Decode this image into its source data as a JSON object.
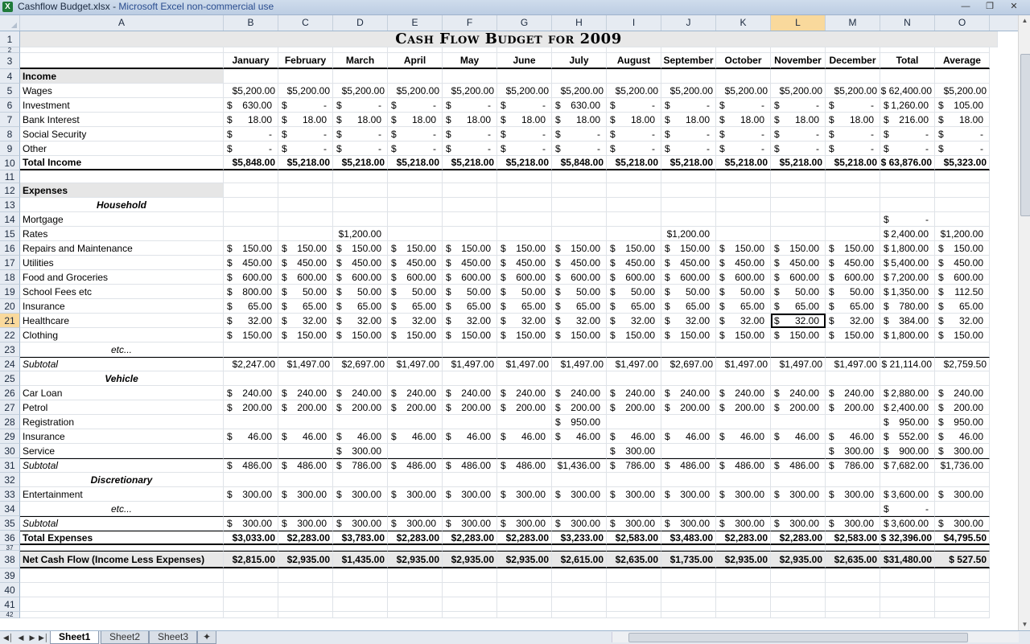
{
  "window": {
    "file_name": "Cashflow Budget.xlsx",
    "separator": " - ",
    "app_name": "Microsoft Excel non-commercial use",
    "icon_label": "X"
  },
  "columns": [
    "A",
    "B",
    "C",
    "D",
    "E",
    "F",
    "G",
    "H",
    "I",
    "J",
    "K",
    "L",
    "M",
    "N",
    "O"
  ],
  "selected_column": "L",
  "selected_row": 21,
  "sheet_title": "Cash Flow Budget for 2009",
  "month_headers": [
    "January",
    "February",
    "March",
    "April",
    "May",
    "June",
    "July",
    "August",
    "September",
    "October",
    "November",
    "December",
    "Total",
    "Average"
  ],
  "rows": [
    {
      "n": 1,
      "type": "title"
    },
    {
      "n": 2,
      "type": "blank"
    },
    {
      "n": 3,
      "type": "headers"
    },
    {
      "n": 4,
      "type": "section",
      "label": "Income"
    },
    {
      "n": 5,
      "label": "Wages",
      "vals": [
        "$5,200.00",
        "$5,200.00",
        "$5,200.00",
        "$5,200.00",
        "$5,200.00",
        "$5,200.00",
        "$5,200.00",
        "$5,200.00",
        "$5,200.00",
        "$5,200.00",
        "$5,200.00",
        "$5,200.00",
        "$ 62,400.00",
        "$5,200.00"
      ],
      "plain": true
    },
    {
      "n": 6,
      "label": "Investment",
      "acc": [
        [
          "$",
          "630.00"
        ],
        [
          "$",
          "-"
        ],
        [
          "$",
          "-"
        ],
        [
          "$",
          "-"
        ],
        [
          "$",
          "-"
        ],
        [
          "$",
          "-"
        ],
        [
          "$",
          "630.00"
        ],
        [
          "$",
          "-"
        ],
        [
          "$",
          "-"
        ],
        [
          "$",
          "-"
        ],
        [
          "$",
          "-"
        ],
        [
          "$",
          "-"
        ],
        [
          "$",
          "1,260.00"
        ],
        [
          "$",
          "105.00"
        ]
      ]
    },
    {
      "n": 7,
      "label": "Bank Interest",
      "acc": [
        [
          "$",
          "18.00"
        ],
        [
          "$",
          "18.00"
        ],
        [
          "$",
          "18.00"
        ],
        [
          "$",
          "18.00"
        ],
        [
          "$",
          "18.00"
        ],
        [
          "$",
          "18.00"
        ],
        [
          "$",
          "18.00"
        ],
        [
          "$",
          "18.00"
        ],
        [
          "$",
          "18.00"
        ],
        [
          "$",
          "18.00"
        ],
        [
          "$",
          "18.00"
        ],
        [
          "$",
          "18.00"
        ],
        [
          "$",
          "216.00"
        ],
        [
          "$",
          "18.00"
        ]
      ]
    },
    {
      "n": 8,
      "label": "Social Security",
      "acc": [
        [
          "$",
          "-"
        ],
        [
          "$",
          "-"
        ],
        [
          "$",
          "-"
        ],
        [
          "$",
          "-"
        ],
        [
          "$",
          "-"
        ],
        [
          "$",
          "-"
        ],
        [
          "$",
          "-"
        ],
        [
          "$",
          "-"
        ],
        [
          "$",
          "-"
        ],
        [
          "$",
          "-"
        ],
        [
          "$",
          "-"
        ],
        [
          "$",
          "-"
        ],
        [
          "$",
          "-"
        ],
        [
          "$",
          "-"
        ]
      ]
    },
    {
      "n": 9,
      "label": "Other",
      "acc": [
        [
          "$",
          "-"
        ],
        [
          "$",
          "-"
        ],
        [
          "$",
          "-"
        ],
        [
          "$",
          "-"
        ],
        [
          "$",
          "-"
        ],
        [
          "$",
          "-"
        ],
        [
          "$",
          "-"
        ],
        [
          "$",
          "-"
        ],
        [
          "$",
          "-"
        ],
        [
          "$",
          "-"
        ],
        [
          "$",
          "-"
        ],
        [
          "$",
          "-"
        ],
        [
          "$",
          "-"
        ],
        [
          "$",
          "-"
        ]
      ]
    },
    {
      "n": 10,
      "label": "Total Income",
      "bold": true,
      "border": "bb2",
      "vals": [
        "$5,848.00",
        "$5,218.00",
        "$5,218.00",
        "$5,218.00",
        "$5,218.00",
        "$5,218.00",
        "$5,848.00",
        "$5,218.00",
        "$5,218.00",
        "$5,218.00",
        "$5,218.00",
        "$5,218.00",
        "$ 63,876.00",
        "$5,323.00"
      ],
      "plain": true
    },
    {
      "n": 11,
      "type": "blank"
    },
    {
      "n": 12,
      "type": "section",
      "label": "Expenses"
    },
    {
      "n": 13,
      "type": "subhead",
      "label": "Household"
    },
    {
      "n": 14,
      "label": "Mortgage",
      "sparse": {
        "12": [
          "$",
          "-"
        ]
      }
    },
    {
      "n": 15,
      "label": "Rates",
      "sparse": {
        "2": [
          "",
          "$1,200.00"
        ],
        "8": [
          "",
          "$1,200.00"
        ],
        "12": [
          "$",
          "2,400.00"
        ],
        "13": [
          "",
          "$1,200.00"
        ]
      }
    },
    {
      "n": 16,
      "label": "Repairs and Maintenance",
      "acc": [
        [
          "$",
          "150.00"
        ],
        [
          "$",
          "150.00"
        ],
        [
          "$",
          "150.00"
        ],
        [
          "$",
          "150.00"
        ],
        [
          "$",
          "150.00"
        ],
        [
          "$",
          "150.00"
        ],
        [
          "$",
          "150.00"
        ],
        [
          "$",
          "150.00"
        ],
        [
          "$",
          "150.00"
        ],
        [
          "$",
          "150.00"
        ],
        [
          "$",
          "150.00"
        ],
        [
          "$",
          "150.00"
        ],
        [
          "$",
          "1,800.00"
        ],
        [
          "$",
          "150.00"
        ]
      ]
    },
    {
      "n": 17,
      "label": "Utilities",
      "acc": [
        [
          "$",
          "450.00"
        ],
        [
          "$",
          "450.00"
        ],
        [
          "$",
          "450.00"
        ],
        [
          "$",
          "450.00"
        ],
        [
          "$",
          "450.00"
        ],
        [
          "$",
          "450.00"
        ],
        [
          "$",
          "450.00"
        ],
        [
          "$",
          "450.00"
        ],
        [
          "$",
          "450.00"
        ],
        [
          "$",
          "450.00"
        ],
        [
          "$",
          "450.00"
        ],
        [
          "$",
          "450.00"
        ],
        [
          "$",
          "5,400.00"
        ],
        [
          "$",
          "450.00"
        ]
      ]
    },
    {
      "n": 18,
      "label": "Food and Groceries",
      "acc": [
        [
          "$",
          "600.00"
        ],
        [
          "$",
          "600.00"
        ],
        [
          "$",
          "600.00"
        ],
        [
          "$",
          "600.00"
        ],
        [
          "$",
          "600.00"
        ],
        [
          "$",
          "600.00"
        ],
        [
          "$",
          "600.00"
        ],
        [
          "$",
          "600.00"
        ],
        [
          "$",
          "600.00"
        ],
        [
          "$",
          "600.00"
        ],
        [
          "$",
          "600.00"
        ],
        [
          "$",
          "600.00"
        ],
        [
          "$",
          "7,200.00"
        ],
        [
          "$",
          "600.00"
        ]
      ]
    },
    {
      "n": 19,
      "label": "School Fees etc",
      "acc": [
        [
          "$",
          "800.00"
        ],
        [
          "$",
          "50.00"
        ],
        [
          "$",
          "50.00"
        ],
        [
          "$",
          "50.00"
        ],
        [
          "$",
          "50.00"
        ],
        [
          "$",
          "50.00"
        ],
        [
          "$",
          "50.00"
        ],
        [
          "$",
          "50.00"
        ],
        [
          "$",
          "50.00"
        ],
        [
          "$",
          "50.00"
        ],
        [
          "$",
          "50.00"
        ],
        [
          "$",
          "50.00"
        ],
        [
          "$",
          "1,350.00"
        ],
        [
          "$",
          "112.50"
        ]
      ]
    },
    {
      "n": 20,
      "label": "Insurance",
      "acc": [
        [
          "$",
          "65.00"
        ],
        [
          "$",
          "65.00"
        ],
        [
          "$",
          "65.00"
        ],
        [
          "$",
          "65.00"
        ],
        [
          "$",
          "65.00"
        ],
        [
          "$",
          "65.00"
        ],
        [
          "$",
          "65.00"
        ],
        [
          "$",
          "65.00"
        ],
        [
          "$",
          "65.00"
        ],
        [
          "$",
          "65.00"
        ],
        [
          "$",
          "65.00"
        ],
        [
          "$",
          "65.00"
        ],
        [
          "$",
          "780.00"
        ],
        [
          "$",
          "65.00"
        ]
      ]
    },
    {
      "n": 21,
      "label": "Healthcare",
      "acc": [
        [
          "$",
          "32.00"
        ],
        [
          "$",
          "32.00"
        ],
        [
          "$",
          "32.00"
        ],
        [
          "$",
          "32.00"
        ],
        [
          "$",
          "32.00"
        ],
        [
          "$",
          "32.00"
        ],
        [
          "$",
          "32.00"
        ],
        [
          "$",
          "32.00"
        ],
        [
          "$",
          "32.00"
        ],
        [
          "$",
          "32.00"
        ],
        [
          "$",
          "32.00"
        ],
        [
          "$",
          "32.00"
        ],
        [
          "$",
          "384.00"
        ],
        [
          "$",
          "32.00"
        ]
      ]
    },
    {
      "n": 22,
      "label": "Clothing",
      "acc": [
        [
          "$",
          "150.00"
        ],
        [
          "$",
          "150.00"
        ],
        [
          "$",
          "150.00"
        ],
        [
          "$",
          "150.00"
        ],
        [
          "$",
          "150.00"
        ],
        [
          "$",
          "150.00"
        ],
        [
          "$",
          "150.00"
        ],
        [
          "$",
          "150.00"
        ],
        [
          "$",
          "150.00"
        ],
        [
          "$",
          "150.00"
        ],
        [
          "$",
          "150.00"
        ],
        [
          "$",
          "150.00"
        ],
        [
          "$",
          "1,800.00"
        ],
        [
          "$",
          "150.00"
        ]
      ]
    },
    {
      "n": 23,
      "type": "etc",
      "label": "etc..."
    },
    {
      "n": 24,
      "label": "Subtotal",
      "italic": true,
      "border": "bt",
      "vals": [
        "$2,247.00",
        "$1,497.00",
        "$2,697.00",
        "$1,497.00",
        "$1,497.00",
        "$1,497.00",
        "$1,497.00",
        "$1,497.00",
        "$2,697.00",
        "$1,497.00",
        "$1,497.00",
        "$1,497.00",
        "$ 21,114.00",
        "$2,759.50"
      ],
      "plain": true
    },
    {
      "n": 25,
      "type": "subhead",
      "label": "Vehicle"
    },
    {
      "n": 26,
      "label": "Car Loan",
      "acc": [
        [
          "$",
          "240.00"
        ],
        [
          "$",
          "240.00"
        ],
        [
          "$",
          "240.00"
        ],
        [
          "$",
          "240.00"
        ],
        [
          "$",
          "240.00"
        ],
        [
          "$",
          "240.00"
        ],
        [
          "$",
          "240.00"
        ],
        [
          "$",
          "240.00"
        ],
        [
          "$",
          "240.00"
        ],
        [
          "$",
          "240.00"
        ],
        [
          "$",
          "240.00"
        ],
        [
          "$",
          "240.00"
        ],
        [
          "$",
          "2,880.00"
        ],
        [
          "$",
          "240.00"
        ]
      ]
    },
    {
      "n": 27,
      "label": "Petrol",
      "acc": [
        [
          "$",
          "200.00"
        ],
        [
          "$",
          "200.00"
        ],
        [
          "$",
          "200.00"
        ],
        [
          "$",
          "200.00"
        ],
        [
          "$",
          "200.00"
        ],
        [
          "$",
          "200.00"
        ],
        [
          "$",
          "200.00"
        ],
        [
          "$",
          "200.00"
        ],
        [
          "$",
          "200.00"
        ],
        [
          "$",
          "200.00"
        ],
        [
          "$",
          "200.00"
        ],
        [
          "$",
          "200.00"
        ],
        [
          "$",
          "2,400.00"
        ],
        [
          "$",
          "200.00"
        ]
      ]
    },
    {
      "n": 28,
      "label": "Registration",
      "sparse": {
        "6": [
          "$",
          "950.00"
        ],
        "12": [
          "$",
          "950.00"
        ],
        "13": [
          "$",
          "950.00"
        ]
      }
    },
    {
      "n": 29,
      "label": "Insurance",
      "acc": [
        [
          "$",
          "46.00"
        ],
        [
          "$",
          "46.00"
        ],
        [
          "$",
          "46.00"
        ],
        [
          "$",
          "46.00"
        ],
        [
          "$",
          "46.00"
        ],
        [
          "$",
          "46.00"
        ],
        [
          "$",
          "46.00"
        ],
        [
          "$",
          "46.00"
        ],
        [
          "$",
          "46.00"
        ],
        [
          "$",
          "46.00"
        ],
        [
          "$",
          "46.00"
        ],
        [
          "$",
          "46.00"
        ],
        [
          "$",
          "552.00"
        ],
        [
          "$",
          "46.00"
        ]
      ]
    },
    {
      "n": 30,
      "label": "Service",
      "sparse": {
        "2": [
          "$",
          "300.00"
        ],
        "7": [
          "$",
          "300.00"
        ],
        "11": [
          "$",
          "300.00"
        ],
        "12": [
          "$",
          "900.00"
        ],
        "13": [
          "$",
          "300.00"
        ]
      }
    },
    {
      "n": 31,
      "label": "Subtotal",
      "italic": true,
      "border": "bt",
      "acc": [
        [
          "$",
          "486.00"
        ],
        [
          "$",
          "486.00"
        ],
        [
          "$",
          "786.00"
        ],
        [
          "$",
          "486.00"
        ],
        [
          "$",
          "486.00"
        ],
        [
          "$",
          "486.00"
        ],
        [
          "",
          "$1,436.00"
        ],
        [
          "$",
          "786.00"
        ],
        [
          "$",
          "486.00"
        ],
        [
          "$",
          "486.00"
        ],
        [
          "$",
          "486.00"
        ],
        [
          "$",
          "786.00"
        ],
        [
          "$",
          "7,682.00"
        ],
        [
          "",
          "$1,736.00"
        ]
      ]
    },
    {
      "n": 32,
      "type": "subhead",
      "label": "Discretionary"
    },
    {
      "n": 33,
      "label": "Entertainment",
      "acc": [
        [
          "$",
          "300.00"
        ],
        [
          "$",
          "300.00"
        ],
        [
          "$",
          "300.00"
        ],
        [
          "$",
          "300.00"
        ],
        [
          "$",
          "300.00"
        ],
        [
          "$",
          "300.00"
        ],
        [
          "$",
          "300.00"
        ],
        [
          "$",
          "300.00"
        ],
        [
          "$",
          "300.00"
        ],
        [
          "$",
          "300.00"
        ],
        [
          "$",
          "300.00"
        ],
        [
          "$",
          "300.00"
        ],
        [
          "$",
          "3,600.00"
        ],
        [
          "$",
          "300.00"
        ]
      ]
    },
    {
      "n": 34,
      "type": "etc",
      "label": "etc...",
      "sparse": {
        "12": [
          "$",
          "-"
        ]
      }
    },
    {
      "n": 35,
      "label": "Subtotal",
      "italic": true,
      "border": "bt",
      "acc": [
        [
          "$",
          "300.00"
        ],
        [
          "$",
          "300.00"
        ],
        [
          "$",
          "300.00"
        ],
        [
          "$",
          "300.00"
        ],
        [
          "$",
          "300.00"
        ],
        [
          "$",
          "300.00"
        ],
        [
          "$",
          "300.00"
        ],
        [
          "$",
          "300.00"
        ],
        [
          "$",
          "300.00"
        ],
        [
          "$",
          "300.00"
        ],
        [
          "$",
          "300.00"
        ],
        [
          "$",
          "300.00"
        ],
        [
          "$",
          "3,600.00"
        ],
        [
          "$",
          "300.00"
        ]
      ]
    },
    {
      "n": 36,
      "label": "Total Expenses",
      "bold": true,
      "border": "bt bb2",
      "vals": [
        "$3,033.00",
        "$2,283.00",
        "$3,783.00",
        "$2,283.00",
        "$2,283.00",
        "$2,283.00",
        "$3,233.00",
        "$2,583.00",
        "$3,483.00",
        "$2,283.00",
        "$2,283.00",
        "$2,583.00",
        "$ 32,396.00",
        "$4,795.50"
      ],
      "plain": true
    },
    {
      "n": 37,
      "type": "blank"
    },
    {
      "n": 38,
      "label": "Net Cash Flow (Income Less Expenses)",
      "bold": true,
      "shade": true,
      "border": "bt bb2",
      "vals": [
        "$2,815.00",
        "$2,935.00",
        "$1,435.00",
        "$2,935.00",
        "$2,935.00",
        "$2,935.00",
        "$2,615.00",
        "$2,635.00",
        "$1,735.00",
        "$2,935.00",
        "$2,935.00",
        "$2,635.00",
        "$31,480.00",
        "$ 527.50"
      ],
      "plain": true
    },
    {
      "n": 39,
      "type": "blank"
    },
    {
      "n": 40,
      "type": "blank"
    },
    {
      "n": 41,
      "type": "blank"
    },
    {
      "n": 42,
      "type": "blank"
    }
  ],
  "sheet_tabs": [
    "Sheet1",
    "Sheet2",
    "Sheet3"
  ],
  "active_sheet": "Sheet1"
}
